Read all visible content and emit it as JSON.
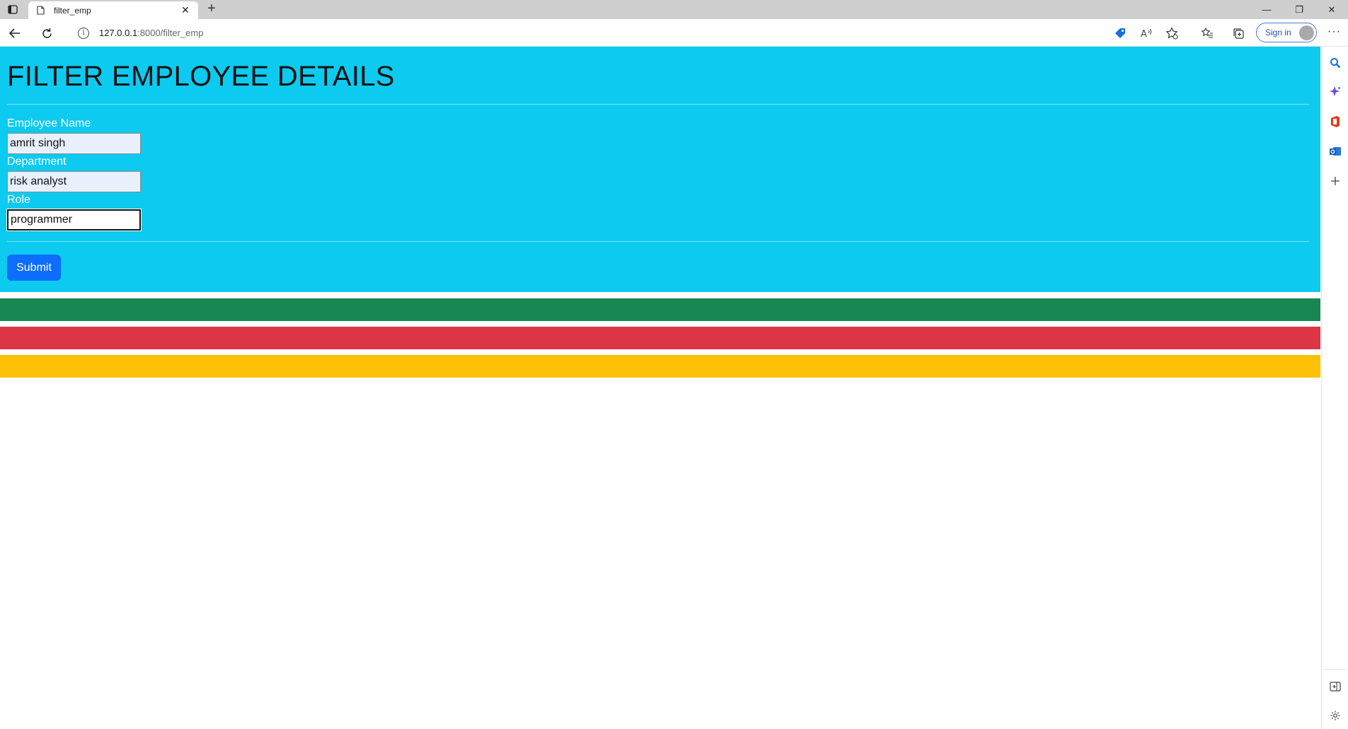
{
  "browser": {
    "tab": {
      "title": "filter_emp",
      "close": "✕"
    },
    "new_tab": "+",
    "window": {
      "minimize": "—",
      "restore": "❐",
      "close": "✕"
    },
    "address": {
      "host": "127.0.0.1",
      "path": ":8000/filter_emp"
    },
    "signin_label": "Sign in",
    "more": "···"
  },
  "page": {
    "title": "FILTER EMPLOYEE DETAILS",
    "fields": [
      {
        "label": "Employee Name",
        "value": "amrit singh"
      },
      {
        "label": "Department",
        "value": "risk analyst"
      },
      {
        "label": "Role",
        "value": "programmer"
      }
    ],
    "submit_label": "Submit",
    "colors": {
      "panel": "#0dcaf0",
      "submit": "#0d6efd",
      "bars": [
        "#198754",
        "#dc3545",
        "#ffc107"
      ]
    }
  }
}
